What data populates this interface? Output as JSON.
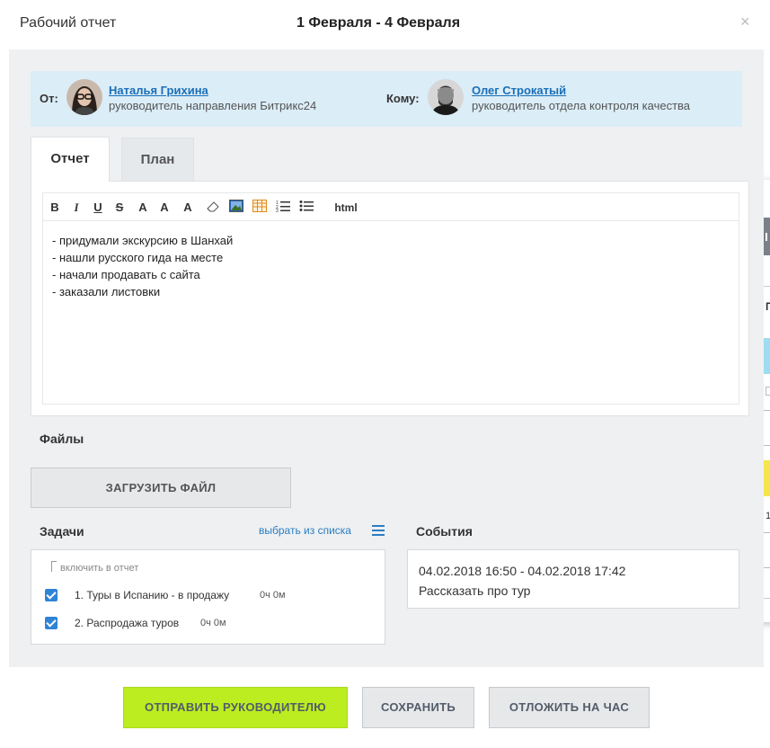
{
  "dialog": {
    "title": "Рабочий отчет",
    "period": "1 Февраля - 4 Февраля",
    "close_glyph": "×"
  },
  "people": {
    "from_label": "От:",
    "from_name": "Наталья Грихина",
    "from_role": "руководитель направления Битрикс24",
    "to_label": "Кому:",
    "to_name": "Олег Строкатый",
    "to_role": "руководитель отдела контроля качества"
  },
  "tabs": [
    {
      "label": "Отчет",
      "active": true
    },
    {
      "label": "План",
      "active": false
    }
  ],
  "toolbar": {
    "bold": "B",
    "italic": "I",
    "underline": "U",
    "strike": "S",
    "font_family": "A",
    "font_size": "A",
    "font_color": "A",
    "html": "html"
  },
  "editor": {
    "lines": [
      "- придумали экскурсию в Шанхай",
      "- нашли русского гида на месте",
      "- начали продавать с сайта",
      "- заказали листовки"
    ]
  },
  "files": {
    "title": "Файлы",
    "upload_label": "ЗАГРУЗИТЬ ФАЙЛ"
  },
  "tasks": {
    "title": "Задачи",
    "choose_link": "выбрать из списка",
    "include_label": "включить в отчет",
    "items": [
      {
        "text": "1. Туры в Испанию - в продажу",
        "time": "0ч 0м",
        "checked": true
      },
      {
        "text": "2. Распродажа туров",
        "time": "0ч 0м",
        "checked": true
      }
    ]
  },
  "events": {
    "title": "События",
    "items": [
      {
        "time": "04.02.2018 16:50 - 04.02.2018 17:42",
        "title": "Рассказать про тур"
      }
    ]
  },
  "footer": {
    "send_label": "ОТПРАВИТЬ РУКОВОДИТЕЛЮ",
    "save_label": "СОХРАНИТЬ",
    "delay_label": "ОТЛОЖИТЬ НА ЧАС"
  },
  "side_panel": {
    "label": "Дл",
    "p": "П",
    "num": "1"
  },
  "colors": {
    "people_bg": "#dbedf7",
    "link": "#1a6fb8",
    "send_btn": "#bbed21",
    "checkbox": "#2f84d6"
  }
}
